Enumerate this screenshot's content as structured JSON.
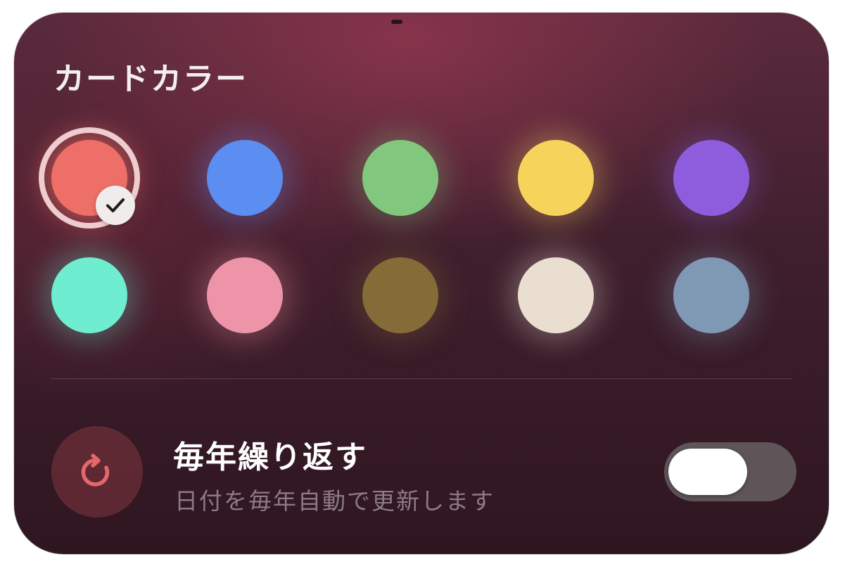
{
  "card_color": {
    "title": "カードカラー",
    "selected_index": 0,
    "swatches": [
      {
        "color": "#ee6f67"
      },
      {
        "color": "#5c8df0"
      },
      {
        "color": "#82c77e"
      },
      {
        "color": "#f6d45c"
      },
      {
        "color": "#8e5ddd"
      },
      {
        "color": "#6fedd1"
      },
      {
        "color": "#ee94a8"
      },
      {
        "color": "#856b38"
      },
      {
        "color": "#eaded0"
      },
      {
        "color": "#7f98b4"
      }
    ]
  },
  "repeat": {
    "icon": "refresh-icon",
    "icon_color": "#e4676b",
    "title": "毎年繰り返す",
    "description": "日付を毎年自動で更新します",
    "toggle_on": false
  }
}
